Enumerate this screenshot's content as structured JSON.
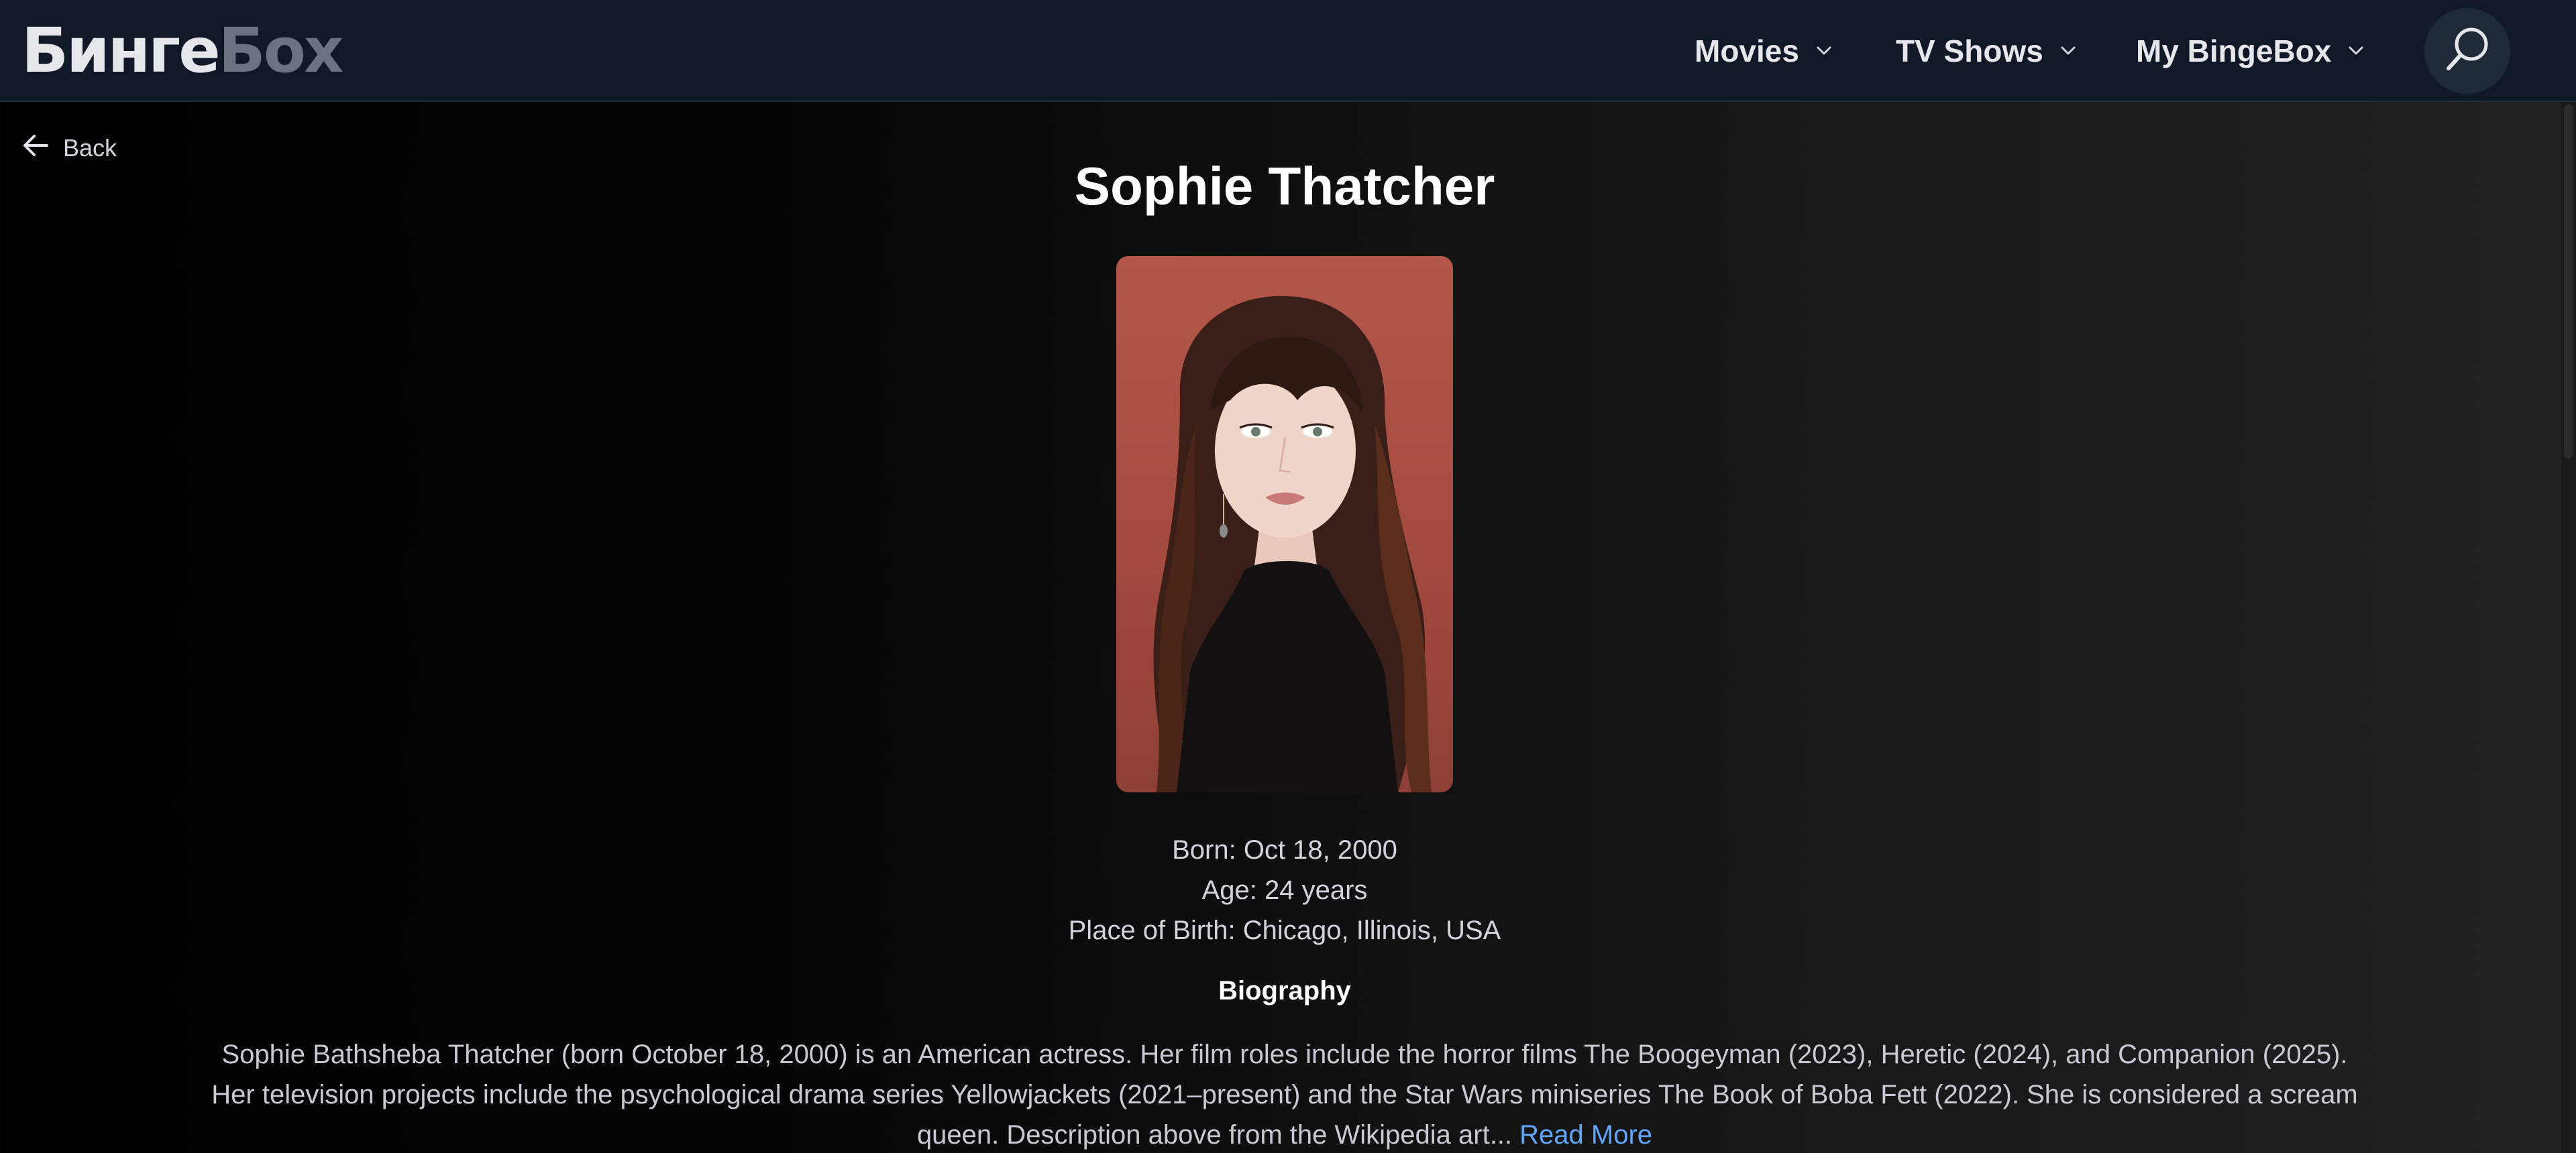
{
  "header": {
    "logo_part1": "Бинге",
    "logo_part2": "Бох",
    "nav": {
      "movies": "Movies",
      "tv_shows": "TV Shows",
      "my_bingebox": "My BingeBox"
    },
    "search_icon": "search-icon",
    "chevron_icon": "chevron-down-icon"
  },
  "back": {
    "label": "Back",
    "icon": "arrow-left-icon"
  },
  "person": {
    "name": "Sophie Thatcher",
    "born": "Born: Oct 18, 2000",
    "age": "Age: 24 years",
    "place_of_birth": "Place of Birth: Chicago, Illinois, USA"
  },
  "biography": {
    "heading": "Biography",
    "text": "Sophie Bathsheba Thatcher (born October 18, 2000) is an American actress. Her film roles include the horror films The Boogeyman (2023), Heretic (2024), and Companion (2025). Her television projects include the psychological drama series Yellowjackets (2021–present) and the Star Wars miniseries The Book of Boba Fett (2022). She is considered a scream queen. Description above from the Wikipedia art...",
    "read_more": "Read More"
  },
  "colors": {
    "header_bg": "#111827",
    "link": "#60a5fa",
    "text": "#d1d5db"
  }
}
